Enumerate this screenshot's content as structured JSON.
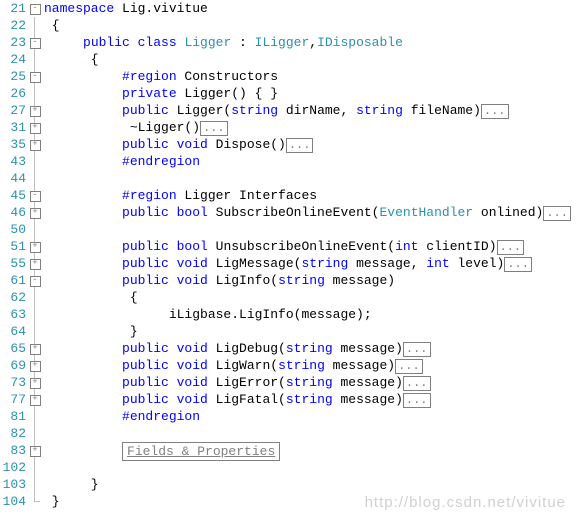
{
  "watermark": "http://blog.csdn.net/vivitue",
  "fold_minus": "-",
  "fold_plus": "+",
  "ellipsis": "...",
  "lines": {
    "l21": {
      "num": "21",
      "ns": "namespace",
      "nsname": " Lig.vivitue"
    },
    "l22": {
      "num": "22",
      "brace": " {"
    },
    "l23": {
      "num": "23",
      "indent": "     ",
      "pub": "public",
      "cls": " class",
      "name": " Ligger",
      "colon": " : ",
      "i1": "ILigger",
      "comma": ",",
      "i2": "IDisposable"
    },
    "l24": {
      "num": "24",
      "brace": "      {"
    },
    "l25": {
      "num": "25",
      "indent": "          ",
      "region": "#region",
      "txt": " Constructors"
    },
    "l26": {
      "num": "26",
      "indent": "          ",
      "priv": "private",
      "txt": " Ligger() { }"
    },
    "l27": {
      "num": "27",
      "indent": "          ",
      "pub": "public",
      "txt1": " Ligger(",
      "str": "string",
      "txt2": " dirName, ",
      "str2": "string",
      "txt3": " fileName)"
    },
    "l31": {
      "num": "31",
      "indent": "           ~Ligger()"
    },
    "l35": {
      "num": "35",
      "indent": "          ",
      "pub": "public",
      "vd": " void",
      "txt": " Dispose()"
    },
    "l43": {
      "num": "43",
      "indent": "          ",
      "endregion": "#endregion"
    },
    "l44": {
      "num": "44"
    },
    "l45": {
      "num": "45",
      "indent": "          ",
      "region": "#region",
      "txt": " Ligger Interfaces"
    },
    "l46": {
      "num": "46",
      "indent": "          ",
      "pub": "public",
      "bool": " bool",
      "txt1": " SubscribeOnlineEvent(",
      "type": "EventHandler",
      "txt2": " onlined)"
    },
    "l50": {
      "num": "50"
    },
    "l51": {
      "num": "51",
      "indent": "          ",
      "pub": "public",
      "bool": " bool",
      "txt1": " UnsubscribeOnlineEvent(",
      "int": "int",
      "txt2": " clientID)"
    },
    "l55": {
      "num": "55",
      "indent": "          ",
      "pub": "public",
      "vd": " void",
      "txt1": " LigMessage(",
      "str": "string",
      "txt2": " message, ",
      "int": "int",
      "txt3": " level)"
    },
    "l61": {
      "num": "61",
      "indent": "          ",
      "pub": "public",
      "vd": " void",
      "txt1": " LigInfo(",
      "str": "string",
      "txt2": " message)"
    },
    "l62": {
      "num": "62",
      "txt": "           {"
    },
    "l63": {
      "num": "63",
      "txt": "                iLigbase.LigInfo(message);"
    },
    "l64": {
      "num": "64",
      "txt": "           }"
    },
    "l65": {
      "num": "65",
      "indent": "          ",
      "pub": "public",
      "vd": " void",
      "txt1": " LigDebug(",
      "str": "string",
      "txt2": " message)"
    },
    "l69": {
      "num": "69",
      "indent": "          ",
      "pub": "public",
      "vd": " void",
      "txt1": " LigWarn(",
      "str": "string",
      "txt2": " message)"
    },
    "l73": {
      "num": "73",
      "indent": "          ",
      "pub": "public",
      "vd": " void",
      "txt1": " LigError(",
      "str": "string",
      "txt2": " message)"
    },
    "l77": {
      "num": "77",
      "indent": "          ",
      "pub": "public",
      "vd": " void",
      "txt1": " LigFatal(",
      "str": "string",
      "txt2": " message)"
    },
    "l81": {
      "num": "81",
      "indent": "          ",
      "endregion": "#endregion"
    },
    "l82": {
      "num": "82"
    },
    "l83": {
      "num": "83",
      "indent": "          ",
      "fields": "Fields & Properties"
    },
    "l102": {
      "num": "102"
    },
    "l103": {
      "num": "103",
      "txt": "      }"
    },
    "l104": {
      "num": "104",
      "txt": " }"
    }
  }
}
